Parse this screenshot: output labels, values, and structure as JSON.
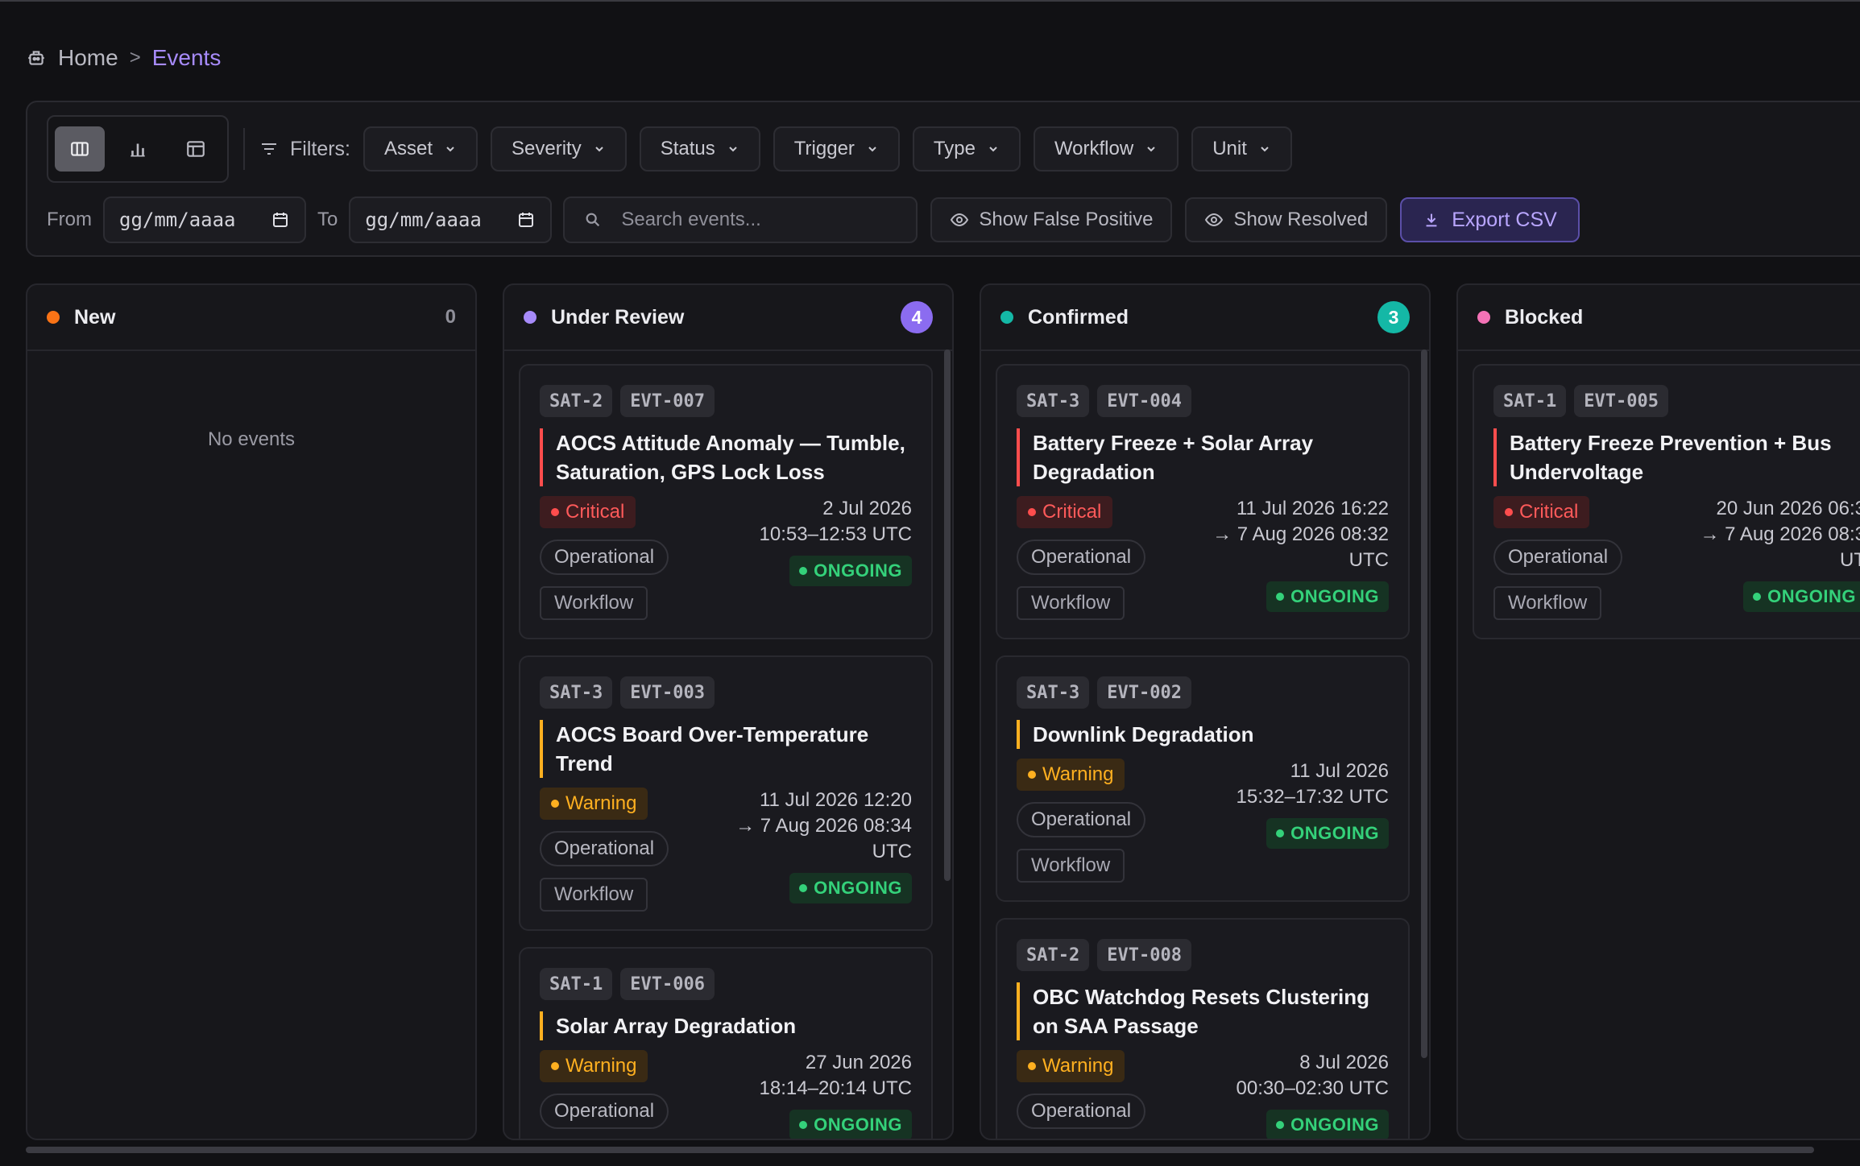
{
  "breadcrumb": {
    "home": "Home",
    "separator": ">",
    "current": "Events"
  },
  "toolbar": {
    "filters_label": "Filters:",
    "filters": [
      "Asset",
      "Severity",
      "Status",
      "Trigger",
      "Type",
      "Workflow",
      "Unit"
    ],
    "from_label": "From",
    "to_label": "To",
    "date_placeholder": "gg/mm/aaaa",
    "search_placeholder": "Search events...",
    "show_false_positive": "Show False Positive",
    "show_resolved": "Show Resolved",
    "export": "Export CSV"
  },
  "colors": {
    "accent": "#a78bfa",
    "new": "#f97316",
    "under_review": "#a78bfa",
    "confirmed": "#14b8a6",
    "blocked": "#f472b6",
    "critical": "#ff4d4d",
    "warning": "#ffb020",
    "ongoing": "#34d17a"
  },
  "columns": [
    {
      "title": "New",
      "count": "0",
      "empty_text": "No events"
    },
    {
      "title": "Under Review",
      "count": "4"
    },
    {
      "title": "Confirmed",
      "count": "3"
    },
    {
      "title": "Blocked",
      "count": ""
    }
  ],
  "cards": {
    "c1": {
      "asset": "SAT-2",
      "id": "EVT-007",
      "title": "AOCS Attitude Anomaly — Tumble, Saturation, GPS Lock Loss",
      "severity": "Critical",
      "type": "Operational",
      "workflow": "Workflow",
      "time1": "2 Jul 2026",
      "time2": "10:53–12:53 UTC",
      "status": "ONGOING"
    },
    "c2": {
      "asset": "SAT-3",
      "id": "EVT-003",
      "title": "AOCS Board Over-Temperature Trend",
      "severity": "Warning",
      "type": "Operational",
      "workflow": "Workflow",
      "time1": "11 Jul 2026 12:20",
      "time2": "→ 7 Aug 2026 08:34",
      "time3": "UTC",
      "status": "ONGOING"
    },
    "c3": {
      "asset": "SAT-1",
      "id": "EVT-006",
      "title": "Solar Array Degradation",
      "severity": "Warning",
      "type": "Operational",
      "time1": "27 Jun 2026",
      "time2": "18:14–20:14 UTC",
      "status": "ONGOING"
    },
    "c4": {
      "asset": "SAT-3",
      "id": "EVT-004",
      "title": "Battery Freeze + Solar Array Degradation",
      "severity": "Critical",
      "type": "Operational",
      "workflow": "Workflow",
      "time1": "11 Jul 2026 16:22",
      "time2": "→ 7 Aug 2026 08:32",
      "time3": "UTC",
      "status": "ONGOING"
    },
    "c5": {
      "asset": "SAT-3",
      "id": "EVT-002",
      "title": "Downlink Degradation",
      "severity": "Warning",
      "type": "Operational",
      "workflow": "Workflow",
      "time1": "11 Jul 2026",
      "time2": "15:32–17:32 UTC",
      "status": "ONGOING"
    },
    "c6": {
      "asset": "SAT-2",
      "id": "EVT-008",
      "title": "OBC Watchdog Resets Clustering on SAA Passage",
      "severity": "Warning",
      "type": "Operational",
      "time1": "8 Jul 2026",
      "time2": "00:30–02:30 UTC",
      "status": "ONGOING"
    },
    "c7": {
      "asset": "SAT-1",
      "id": "EVT-005",
      "title": "Battery Freeze Prevention + Bus Undervoltage",
      "severity": "Critical",
      "type": "Operational",
      "workflow": "Workflow",
      "time1": "20 Jun 2026 06:3",
      "time2": "→ 7 Aug 2026 08:3",
      "time3": "UT",
      "status": "ONGOING"
    }
  }
}
